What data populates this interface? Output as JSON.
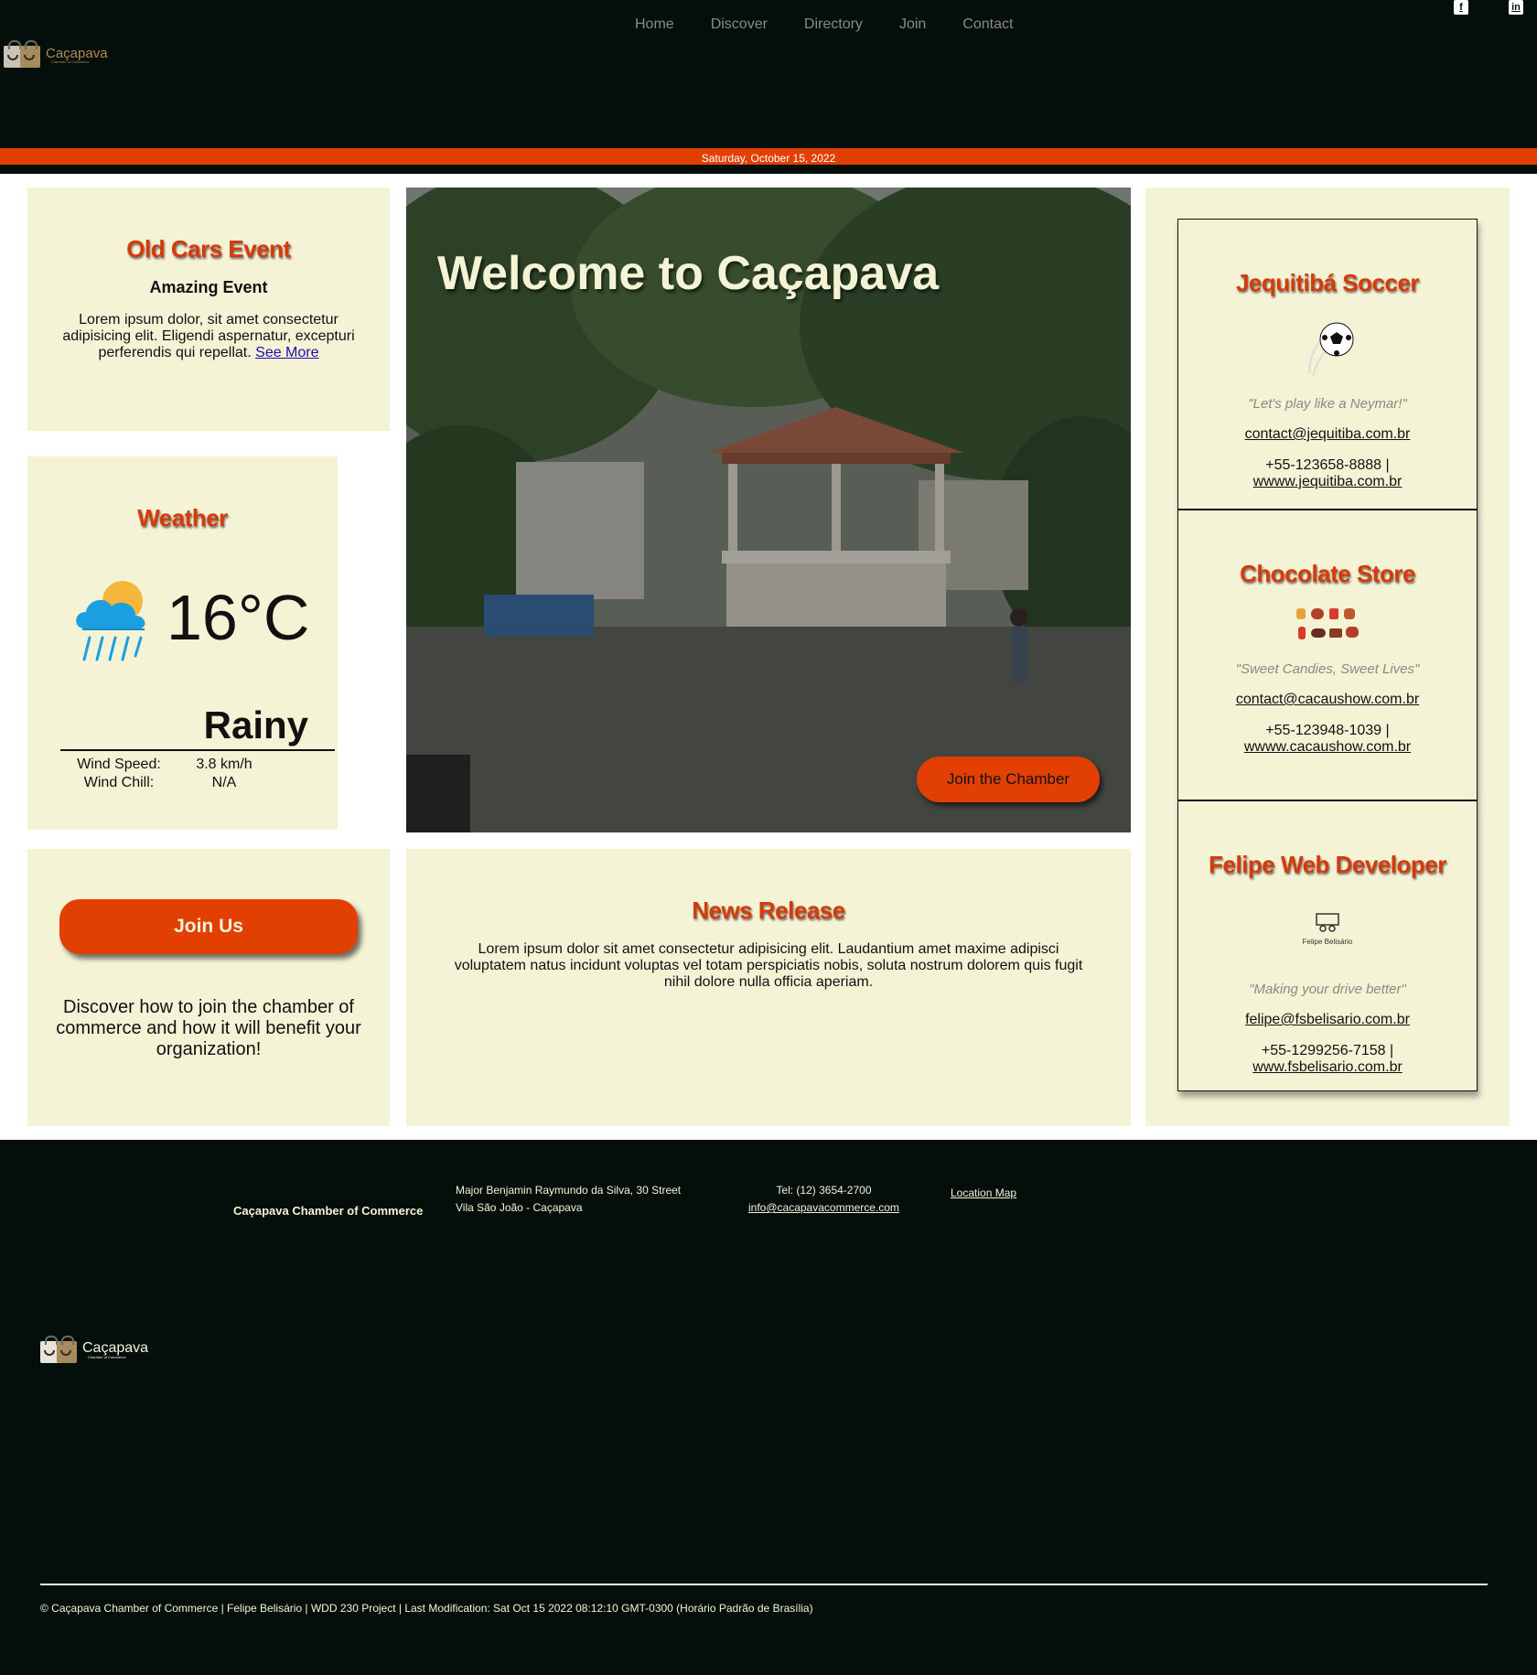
{
  "header": {
    "logo_name": "Caçapava",
    "logo_subtitle": "Chamber of Commerce",
    "nav": [
      "Home",
      "Discover",
      "Directory",
      "Join",
      "Contact"
    ],
    "social": [
      "facebook-icon",
      "linkedin-icon"
    ],
    "date": "Saturday, October 15, 2022"
  },
  "colors": {
    "background": "#040f0b",
    "accent": "#e24003",
    "card": "#f5f3d6",
    "heading": "#d63a08"
  },
  "event": {
    "title": "Old Cars Event",
    "subtitle": "Amazing Event",
    "text": "Lorem ipsum dolor, sit amet consectetur adipisicing elit. Eligendi aspernatur, excepturi perferendis qui repellat.",
    "link": "See More"
  },
  "weather": {
    "title": "Weather",
    "icon": "rain-cloud-sun-icon",
    "temperature": "16°C",
    "condition": "Rainy",
    "wind_speed_label": "Wind Speed:",
    "wind_speed": "3.8 km/h",
    "wind_chill_label": "Wind Chill:",
    "wind_chill": "N/A"
  },
  "hero": {
    "title": "Welcome to Caçapava",
    "button": "Join the Chamber"
  },
  "join": {
    "button": "Join Us",
    "text": "Discover how to join the chamber of commerce and how it will benefit your organization!"
  },
  "news": {
    "title": "News Release",
    "text": "Lorem ipsum dolor sit amet consectetur adipisicing elit. Laudantium amet maxime adipisci voluptatem natus incidunt voluptas vel totam perspiciatis nobis, soluta nostrum dolorem quis fugit nihil dolore nulla officia aperiam."
  },
  "directory": [
    {
      "name": "Jequitibá Soccer",
      "icon": "soccer-ball-icon",
      "quote": "\"Let's play like a Neymar!\"",
      "email": "contact@jequitiba.com.br",
      "phone": "+55-123658-8888 |",
      "website": "wwww.jequitiba.com.br"
    },
    {
      "name": "Chocolate Store",
      "icon": "chocolates-icon",
      "quote": "\"Sweet Candies, Sweet Lives\"",
      "email": "contact@cacaushow.com.br",
      "phone": "+55-123948-1039 |",
      "website": "wwww.cacaushow.com.br"
    },
    {
      "name": "Felipe Web Developer",
      "icon": "developer-logo-icon",
      "logo_text": "Felipe Belisário",
      "quote": "\"Making your drive better\"",
      "email": "felipe@fsbelisario.com.br",
      "phone": "+55-1299256-7158 |",
      "website": "www.fsbelisario.com.br"
    }
  ],
  "footer": {
    "name": "Caçapava Chamber of Commerce",
    "address_line1": "Major Benjamin Raymundo da Silva, 30 Street",
    "address_line2": "Vila São João - Caçapava",
    "tel": "Tel: (12) 3654-2700",
    "email": "info@cacapavacommerce.com",
    "map_link": "Location Map",
    "logo_name": "Caçapava",
    "logo_subtitle": "Chamber of Commerce",
    "copyright": "© Caçapava Chamber of Commerce | Felipe Belisário | WDD 230 Project | Last Modification: Sat Oct 15 2022 08:12:10 GMT-0300 (Horário Padrão de Brasília)"
  }
}
